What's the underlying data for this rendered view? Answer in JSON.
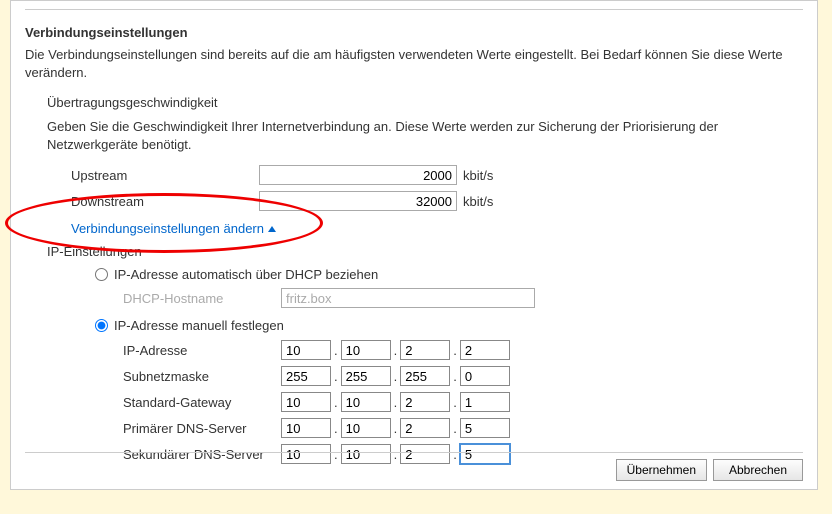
{
  "section_title": "Verbindungseinstellungen",
  "section_desc": "Die Verbindungseinstellungen sind bereits auf die am häufigsten verwendeten Werte eingestellt. Bei Bedarf können Sie diese Werte verändern.",
  "speed": {
    "title": "Übertragungsgeschwindigkeit",
    "desc": "Geben Sie die Geschwindigkeit Ihrer Internetverbindung an. Diese Werte werden zur Sicherung der Priorisierung der Netzwerkgeräte benötigt.",
    "upstream_label": "Upstream",
    "upstream_value": "2000",
    "downstream_label": "Downstream",
    "downstream_value": "32000",
    "unit": "kbit/s"
  },
  "collapse_link": "Verbindungseinstellungen ändern",
  "ip": {
    "title": "IP-Einstellungen",
    "radio_dhcp": "IP-Adresse automatisch über DHCP beziehen",
    "dhcp_hostname_label": "DHCP-Hostname",
    "dhcp_hostname_value": "fritz.box",
    "radio_manual": "IP-Adresse manuell festlegen",
    "rows": {
      "addr_label": "IP-Adresse",
      "addr": [
        "10",
        "10",
        "2",
        "2"
      ],
      "mask_label": "Subnetzmaske",
      "mask": [
        "255",
        "255",
        "255",
        "0"
      ],
      "gw_label": "Standard-Gateway",
      "gw": [
        "10",
        "10",
        "2",
        "1"
      ],
      "dns1_label": "Primärer DNS-Server",
      "dns1": [
        "10",
        "10",
        "2",
        "5"
      ],
      "dns2_label": "Sekundärer DNS-Server",
      "dns2": [
        "10",
        "10",
        "2",
        "5"
      ]
    }
  },
  "buttons": {
    "apply": "Übernehmen",
    "cancel": "Abbrechen"
  }
}
